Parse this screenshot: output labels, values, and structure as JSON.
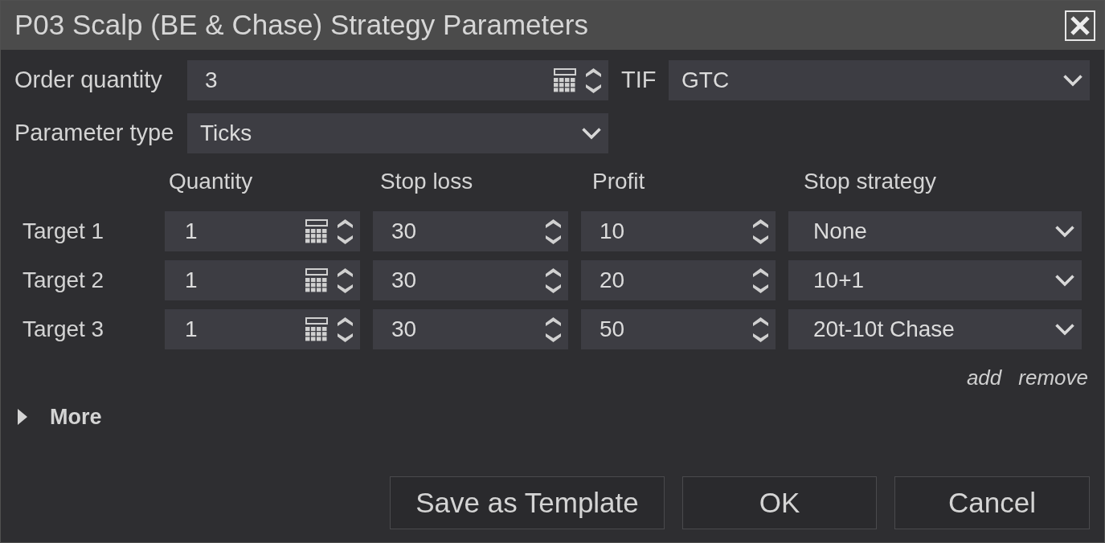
{
  "window": {
    "title": "P03 Scalp (BE & Chase) Strategy Parameters"
  },
  "order_quantity": {
    "label": "Order quantity",
    "value": "3"
  },
  "tif": {
    "label": "TIF",
    "value": "GTC"
  },
  "parameter_type": {
    "label": "Parameter type",
    "value": "Ticks"
  },
  "targets": {
    "columns": [
      {
        "label": "Quantity",
        "kind": "calculator"
      },
      {
        "label": "Stop loss",
        "kind": "spinner"
      },
      {
        "label": "Profit",
        "kind": "spinner"
      },
      {
        "label": "Stop strategy",
        "kind": "dropdown"
      }
    ],
    "rows": [
      {
        "label": "Target 1",
        "cells": [
          "1",
          "30",
          "10",
          "None"
        ]
      },
      {
        "label": "Target 2",
        "cells": [
          "1",
          "30",
          "20",
          "10+1"
        ]
      },
      {
        "label": "Target 3",
        "cells": [
          "1",
          "30",
          "50",
          "20t-10t Chase"
        ]
      }
    ]
  },
  "row_actions": [
    "add",
    "remove"
  ],
  "more": {
    "label": "More",
    "expanded": false
  },
  "buttons": [
    "Save as Template",
    "OK",
    "Cancel"
  ]
}
